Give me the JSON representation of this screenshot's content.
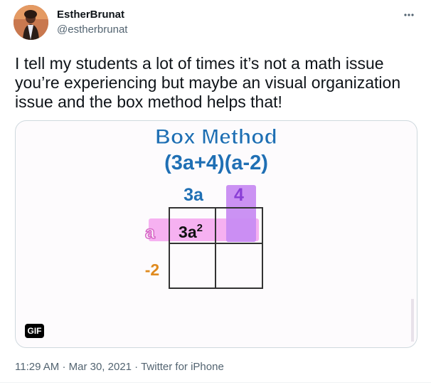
{
  "author": {
    "name": "EstherBrunat",
    "handle": "@estherbrunat"
  },
  "more_icon": "more-horizontal-icon",
  "tweet": {
    "text": "I tell my students a lot of times it’s not a math issue you’re experiencing but maybe an visual organization issue and the box method helps that!"
  },
  "media": {
    "type": "gif",
    "badge_label": "GIF",
    "title_line1": "Box Method",
    "title_line2": "(3a+4)(a-2)",
    "col_labels": [
      "3a",
      "4"
    ],
    "row_labels": [
      "a",
      "-2"
    ],
    "cell_value_main": "3a",
    "cell_value_exp": "2",
    "colors": {
      "title": "#1f6fb4",
      "pink_highlight": "#f5a8ef",
      "purple_highlight": "#c88cf2",
      "row_label_a": "#d86bc8",
      "row_label_neg2": "#e08a1e",
      "col_label_4": "#8a3fd6"
    }
  },
  "footer": {
    "time": "11:29 AM",
    "separator": "·",
    "date": "Mar 30, 2021",
    "source": "Twitter for iPhone"
  }
}
